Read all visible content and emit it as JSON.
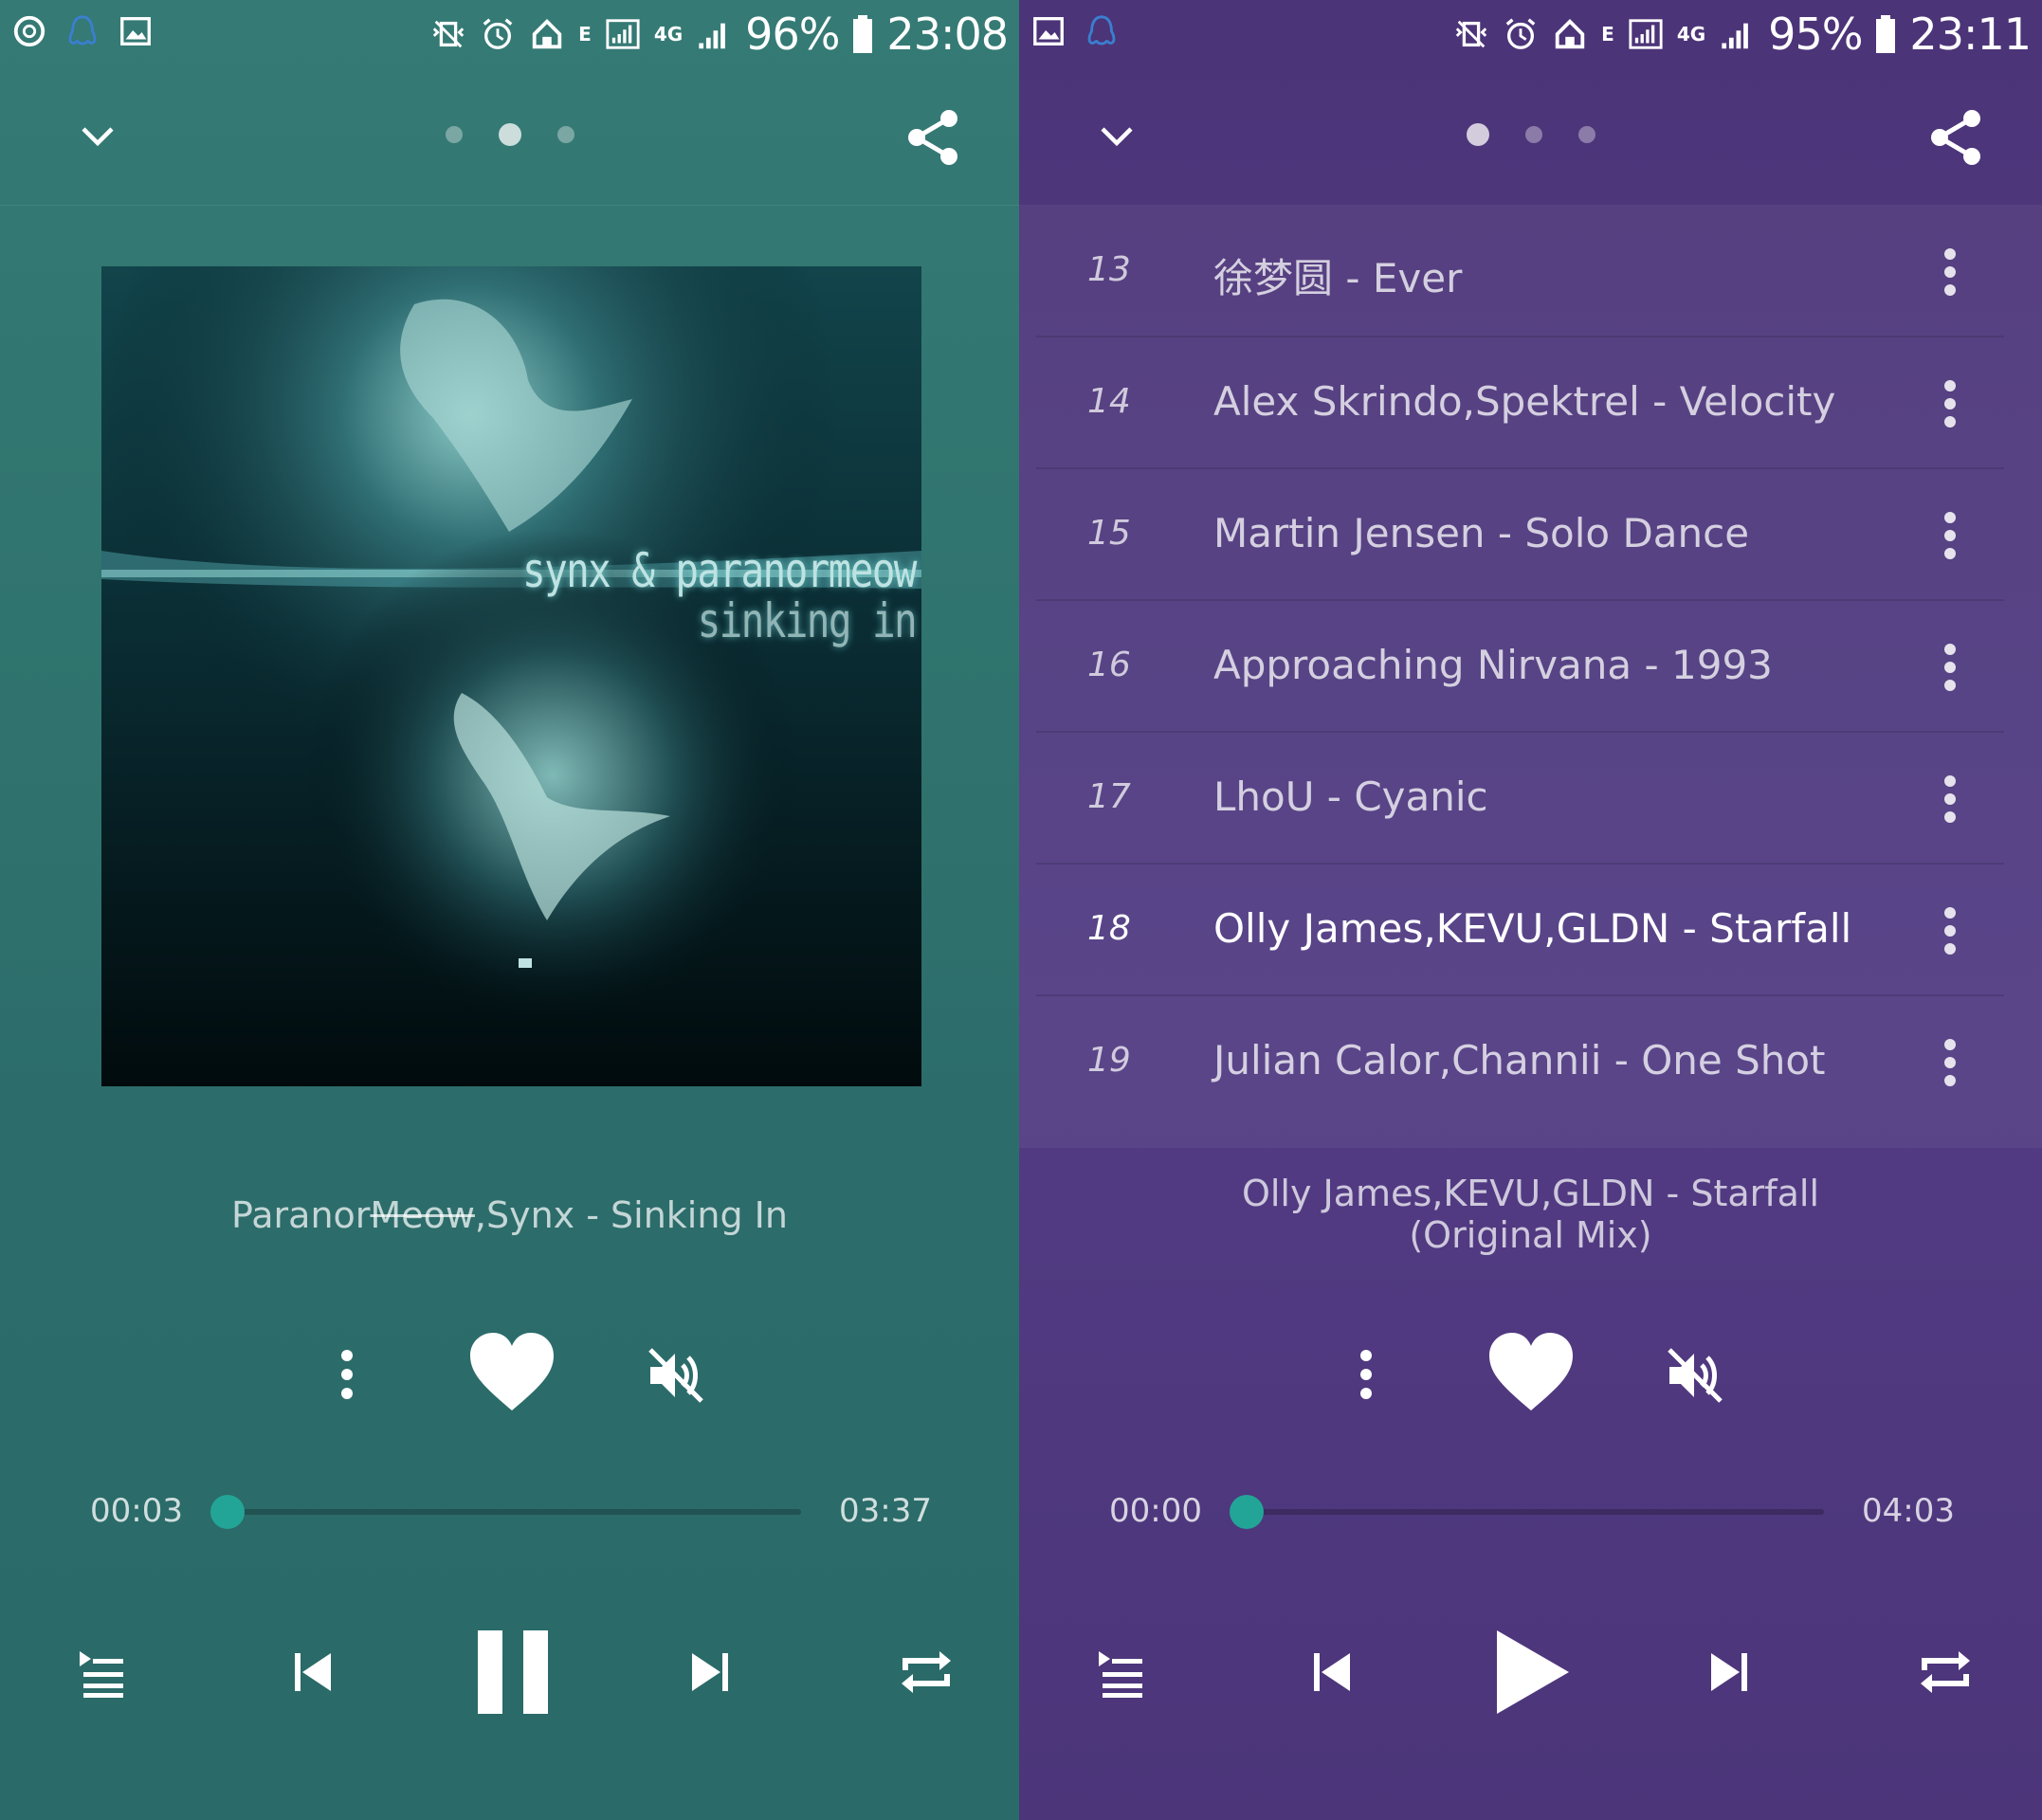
{
  "left_screen": {
    "status_bar": {
      "battery_percent": "96%",
      "time": "23:08",
      "network_e": "E",
      "network_4g": "4G"
    },
    "pager": {
      "pages": 3,
      "active_index": 1
    },
    "album_art": {
      "line1": "synx & paranormeow",
      "line2": "sinking in"
    },
    "track": {
      "title_part1": "Paranor",
      "title_struck": "Meow",
      "title_part2": ",Synx - Sinking In"
    },
    "progress": {
      "current": "00:03",
      "total": "03:37",
      "fraction": 0.0
    },
    "state": "playing",
    "icons": {
      "back": "chevron-down-icon",
      "share": "share-icon",
      "more": "more-vert-icon",
      "favorite": "heart-icon",
      "mute": "volume-off-icon",
      "queue": "queue-icon",
      "previous": "skip-previous-icon",
      "pause": "pause-icon",
      "next": "skip-next-icon",
      "repeat": "repeat-icon"
    },
    "colors": {
      "background": "#327571",
      "accent": "#22a597"
    }
  },
  "right_screen": {
    "status_bar": {
      "battery_percent": "95%",
      "time": "23:11",
      "network_e": "E",
      "network_4g": "4G"
    },
    "pager": {
      "pages": 3,
      "active_index": 0
    },
    "playlist": [
      {
        "number": "13",
        "title": "徐梦圆 - Ever",
        "active": false
      },
      {
        "number": "14",
        "title": "Alex Skrindo,Spektrel - Velocity",
        "active": false
      },
      {
        "number": "15",
        "title": "Martin Jensen - Solo Dance",
        "active": false
      },
      {
        "number": "16",
        "title": "Approaching Nirvana - 1993",
        "active": false
      },
      {
        "number": "17",
        "title": "LhoU - Cyanic",
        "active": false
      },
      {
        "number": "18",
        "title": "Olly James,KEVU,GLDN - Starfall",
        "active": true
      },
      {
        "number": "19",
        "title": "Julian Calor,Channii - One Shot",
        "active": false
      }
    ],
    "track": {
      "title": "Olly James,KEVU,GLDN - Starfall (Original Mix)"
    },
    "progress": {
      "current": "00:00",
      "total": "04:03",
      "fraction": 0.0
    },
    "state": "paused",
    "icons": {
      "back": "chevron-down-icon",
      "share": "share-icon",
      "row_more": "more-vert-icon",
      "more": "more-vert-icon",
      "favorite": "heart-icon",
      "mute": "volume-off-icon",
      "queue": "queue-icon",
      "previous": "skip-previous-icon",
      "play": "play-icon",
      "next": "skip-next-icon",
      "repeat": "repeat-icon"
    },
    "colors": {
      "background": "#4f3a80",
      "accent": "#22a597"
    }
  }
}
